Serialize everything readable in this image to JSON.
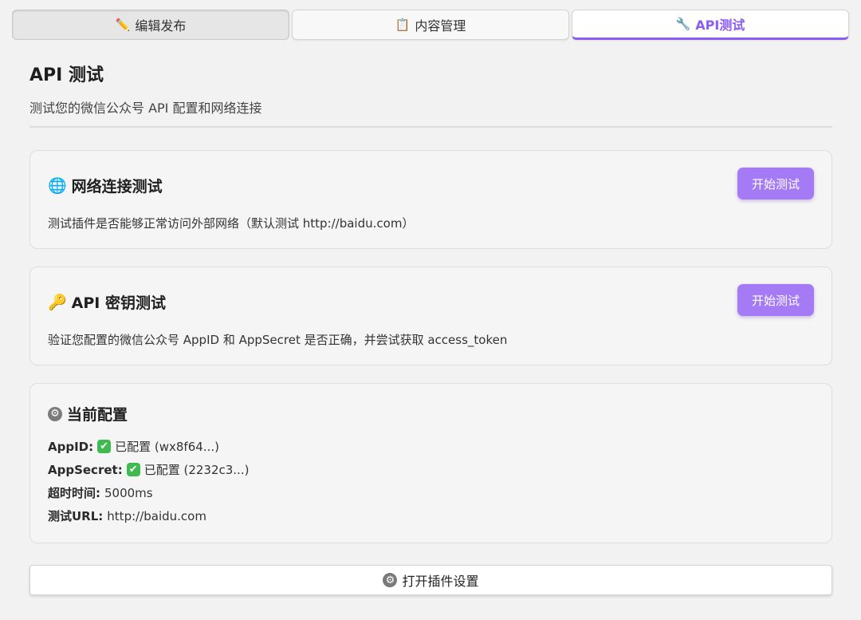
{
  "tabs": [
    {
      "icon": "pencil-icon",
      "glyph": "✏️",
      "label": "编辑发布"
    },
    {
      "icon": "clipboard-icon",
      "glyph": "📋",
      "label": "内容管理"
    },
    {
      "icon": "wrench-icon",
      "glyph": "🔧",
      "label": "API测试"
    }
  ],
  "header": {
    "title": "API 测试",
    "subtitle": "测试您的微信公众号 API 配置和网络连接"
  },
  "network_test": {
    "icon_glyph": "🌐",
    "title": "网络连接测试",
    "description": "测试插件是否能够正常访问外部网络（默认测试 http://baidu.com）",
    "button_label": "开始测试"
  },
  "api_key_test": {
    "icon_glyph": "🔑",
    "title": "API 密钥测试",
    "description": "验证您配置的微信公众号 AppID 和 AppSecret 是否正确，并尝试获取 access_token",
    "button_label": "开始测试"
  },
  "current_config": {
    "icon_glyph": "⚙",
    "title": "当前配置",
    "rows": [
      {
        "key": "AppID:",
        "check": "✔",
        "value": "已配置 (wx8f64...)"
      },
      {
        "key": "AppSecret:",
        "check": "✔",
        "value": "已配置 (2232c3...)"
      },
      {
        "key": "超时时间:",
        "value": "5000ms"
      },
      {
        "key": "测试URL:",
        "value": "http://baidu.com"
      }
    ]
  },
  "open_settings": {
    "icon_glyph": "⚙",
    "label": "打开插件设置"
  },
  "colors": {
    "accent": "#8b5cf6",
    "button": "#a47bf5",
    "check": "#3fb950"
  }
}
